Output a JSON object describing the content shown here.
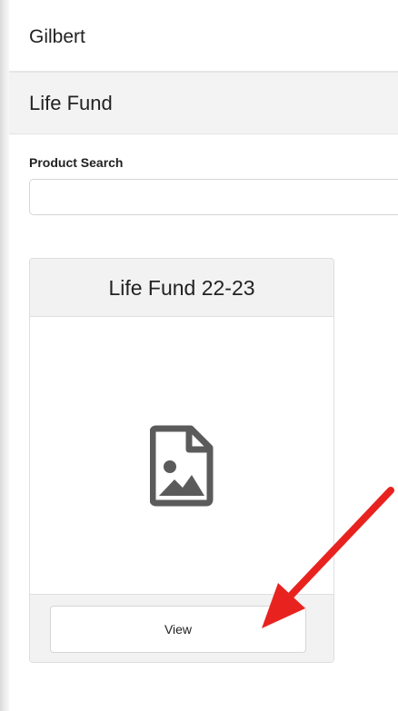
{
  "header": {
    "title": "Gilbert"
  },
  "section": {
    "title": "Life Fund"
  },
  "search": {
    "label": "Product Search",
    "value": "",
    "placeholder": ""
  },
  "product_card": {
    "title": "Life Fund 22-23",
    "image_icon": "image-file-icon",
    "view_label": "View"
  },
  "annotation": {
    "icon": "red-arrow-icon",
    "color": "#e8231f"
  },
  "colors": {
    "header_bg": "#ffffff",
    "section_bg": "#f3f3f3",
    "card_header_bg": "#f2f2f2",
    "icon_color": "#5b5b5b"
  }
}
